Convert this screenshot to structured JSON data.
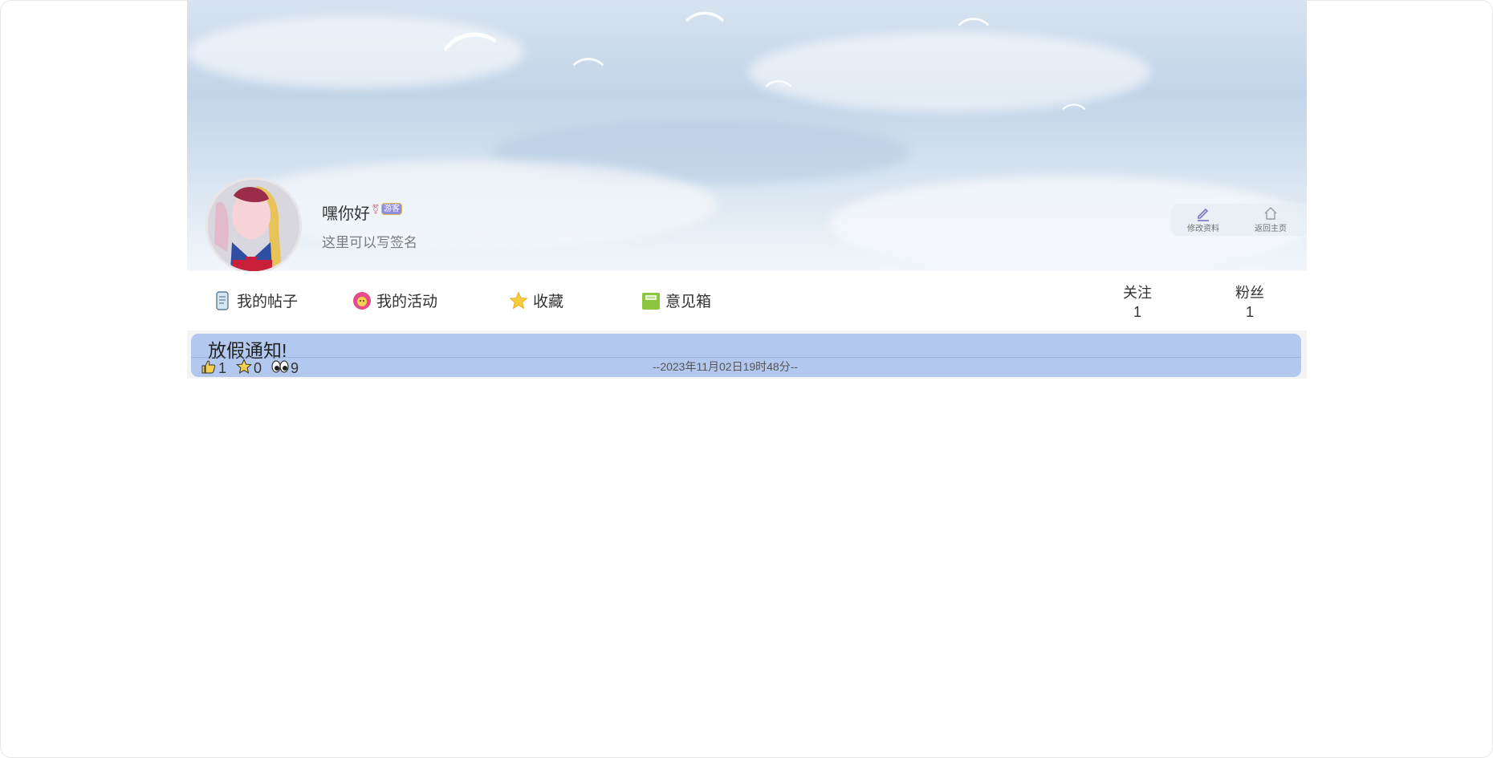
{
  "profile": {
    "username": "嘿你好",
    "role_badge": "游客",
    "signature": "这里可以写签名",
    "gender_icon": "gender-icon"
  },
  "actions": {
    "edit_profile": "修改资料",
    "back_home": "返回主页"
  },
  "nav": {
    "my_posts": "我的帖子",
    "my_activities": "我的活动",
    "favorites": "收藏",
    "feedback": "意见箱"
  },
  "stats": {
    "following_label": "关注",
    "following_count": "1",
    "followers_label": "粉丝",
    "followers_count": "1"
  },
  "posts": [
    {
      "title": "放假通知!",
      "likes": "1",
      "stars": "0",
      "views": "9",
      "date": "--2023年11月02日19时48分--"
    }
  ],
  "colors": {
    "post_bg": "#b2c8ee",
    "accent": "#8f8be0"
  }
}
